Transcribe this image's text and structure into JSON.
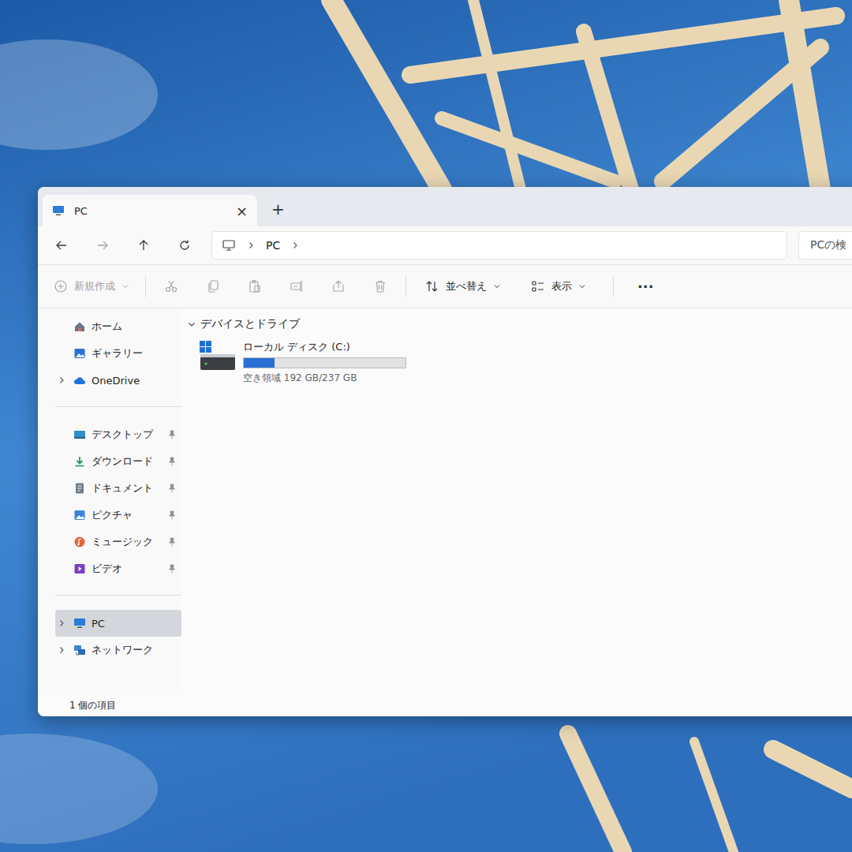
{
  "window": {
    "title": "PC",
    "close": "×",
    "new_tab": "+"
  },
  "nav": {
    "back_disabled": false,
    "forward_disabled": true,
    "up_disabled": false,
    "refresh_disabled": false
  },
  "address": {
    "segments": [
      "PC"
    ]
  },
  "search": {
    "placeholder": "PCの検"
  },
  "toolbar": {
    "new": {
      "label": "新規作成",
      "disabled": true
    },
    "actions": [
      {
        "kind": "cut",
        "disabled": true
      },
      {
        "kind": "copy",
        "disabled": true
      },
      {
        "kind": "paste",
        "disabled": true
      },
      {
        "kind": "rename",
        "disabled": true
      },
      {
        "kind": "share",
        "disabled": true
      },
      {
        "kind": "delete",
        "disabled": true
      }
    ],
    "sort": {
      "label": "並べ替え"
    },
    "view": {
      "label": "表示"
    },
    "more": "···"
  },
  "sidebar": {
    "groups": [
      [
        {
          "label": "ホーム",
          "kind": "home",
          "expander": false,
          "expanded": false,
          "pinned": false,
          "selected": false
        },
        {
          "label": "ギャラリー",
          "kind": "gallery",
          "expander": false,
          "expanded": false,
          "pinned": false,
          "selected": false
        },
        {
          "label": "OneDrive",
          "kind": "onedrive",
          "expander": true,
          "expanded": false,
          "pinned": false,
          "selected": false
        }
      ],
      [
        {
          "label": "デスクトップ",
          "kind": "desktop",
          "expander": false,
          "expanded": false,
          "pinned": true,
          "selected": false
        },
        {
          "label": "ダウンロード",
          "kind": "download",
          "expander": false,
          "expanded": false,
          "pinned": true,
          "selected": false
        },
        {
          "label": "ドキュメント",
          "kind": "documents",
          "expander": false,
          "expanded": false,
          "pinned": true,
          "selected": false
        },
        {
          "label": "ピクチャ",
          "kind": "pictures",
          "expander": false,
          "expanded": false,
          "pinned": true,
          "selected": false
        },
        {
          "label": "ミュージック",
          "kind": "music",
          "expander": false,
          "expanded": false,
          "pinned": true,
          "selected": false
        },
        {
          "label": "ビデオ",
          "kind": "videos",
          "expander": false,
          "expanded": false,
          "pinned": true,
          "selected": false
        }
      ],
      [
        {
          "label": "PC",
          "kind": "pc",
          "expander": true,
          "expanded": false,
          "pinned": false,
          "selected": true
        },
        {
          "label": "ネットワーク",
          "kind": "network",
          "expander": true,
          "expanded": false,
          "pinned": false,
          "selected": false
        }
      ]
    ]
  },
  "groups": [
    {
      "label": "デバイスとドライブ",
      "expanded": true,
      "drives": [
        {
          "name": "ローカル ディスク (C:)",
          "level": 0.19,
          "reading": "空き領域 192 GB/237 GB"
        }
      ]
    }
  ],
  "status_bar": {
    "count": "1 個の項目"
  }
}
